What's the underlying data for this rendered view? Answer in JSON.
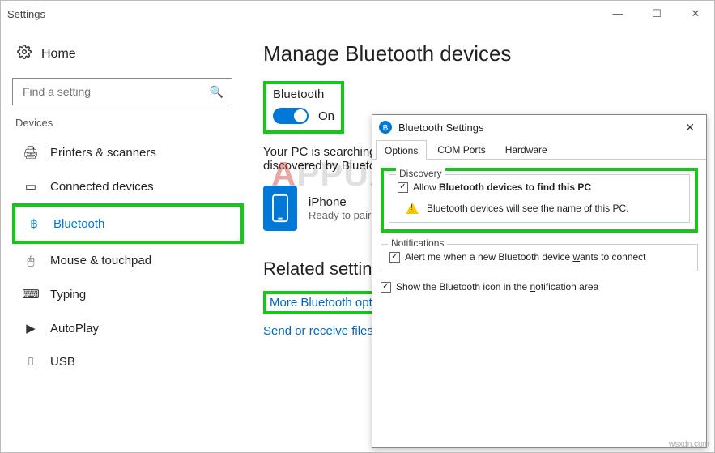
{
  "window": {
    "title": "Settings"
  },
  "titlebar_buttons": {
    "min": "—",
    "max": "☐",
    "close": "✕"
  },
  "home_label": "Home",
  "search": {
    "placeholder": "Find a setting"
  },
  "devices_label": "Devices",
  "nav": {
    "printers": "Printers & scanners",
    "connected": "Connected devices",
    "bluetooth": "Bluetooth",
    "mouse": "Mouse & touchpad",
    "typing": "Typing",
    "autoplay": "AutoPlay",
    "usb": "USB"
  },
  "main": {
    "title": "Manage Bluetooth devices",
    "bt_label": "Bluetooth",
    "bt_state": "On",
    "status_text": "Your PC is searching for and can be discovered by Bluetooth devices.",
    "device": {
      "name": "iPhone",
      "status": "Ready to pair"
    },
    "related_head": "Related settings",
    "link_more": "More Bluetooth options",
    "link_send": "Send or receive files via Bluetooth"
  },
  "dialog": {
    "title": "Bluetooth Settings",
    "tabs": {
      "options": "Options",
      "com": "COM Ports",
      "hardware": "Hardware"
    },
    "discovery": {
      "legend": "Discovery",
      "allow_prefix": "Allow ",
      "allow_bold": "Bluetooth devices to find this PC",
      "warn_text": "Bluetooth devices will see the name of this PC."
    },
    "notifications": {
      "legend": "Notifications",
      "alert_prefix": "Alert me when a new Bluetooth device ",
      "alert_u": "w",
      "alert_suffix": "ants to connect"
    },
    "show_icon_prefix": "Show the Bluetooth icon in the ",
    "show_icon_u": "n",
    "show_icon_suffix": "otification area"
  },
  "watermark": {
    "a": "A",
    "rest": "PPUALS"
  },
  "corner": "wsxdn.com"
}
